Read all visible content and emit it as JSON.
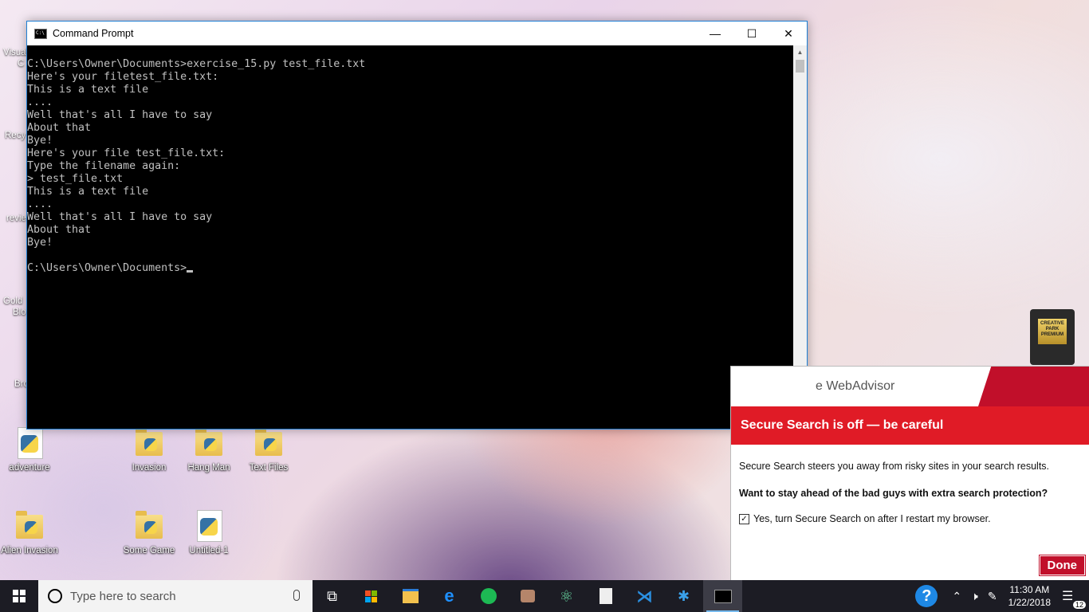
{
  "desktop": {
    "icons": [
      {
        "label": "adventure"
      },
      {
        "label": "Invasion"
      },
      {
        "label": "Hang Man"
      },
      {
        "label": "Text Files"
      },
      {
        "label": "Alien Invasion"
      },
      {
        "label": "Some Game"
      },
      {
        "label": "Untitled-1"
      }
    ],
    "partial_labels": [
      "Visual",
      "C",
      "Recy",
      "revie",
      "Gold",
      "Blo",
      "Bro"
    ]
  },
  "cmd_window": {
    "title": "Command Prompt",
    "minimize": "—",
    "maximize": "☐",
    "close": "✕",
    "lines": [
      "C:\\Users\\Owner\\Documents>exercise_15.py test_file.txt",
      "Here's your filetest_file.txt:",
      "This is a text file",
      "....",
      "Well that's all I have to say",
      "About that",
      "Bye!",
      "Here's your file test_file.txt:",
      "Type the filename again:",
      "> test_file.txt",
      "This is a text file",
      "....",
      "Well that's all I have to say",
      "About that",
      "Bye!",
      "",
      "C:\\Users\\Owner\\Documents>"
    ]
  },
  "creative_park": {
    "label": "CREATIVE PARK PREMIUM"
  },
  "mcafee": {
    "brand": "e WebAdvisor",
    "banner": "Secure Search is off — be careful",
    "description": "Secure Search steers you away from risky sites in your search results.",
    "question": "Want to stay ahead of the bad guys with extra search protection?",
    "checkbox_label": "Yes, turn Secure Search on after I restart my browser.",
    "checkbox_checked": true,
    "done_label": "Done",
    "accent_color": "#c10f2a"
  },
  "taskbar": {
    "search_placeholder": "Type here to search",
    "apps": [
      "task-view",
      "store",
      "file-explorer",
      "edge",
      "spotify",
      "game",
      "atom",
      "python-editor",
      "vscode",
      "app",
      "command-prompt"
    ],
    "active_app": "command-prompt",
    "clock_time": "11:30 AM",
    "clock_date": "1/22/2018",
    "notification_count": "12"
  }
}
